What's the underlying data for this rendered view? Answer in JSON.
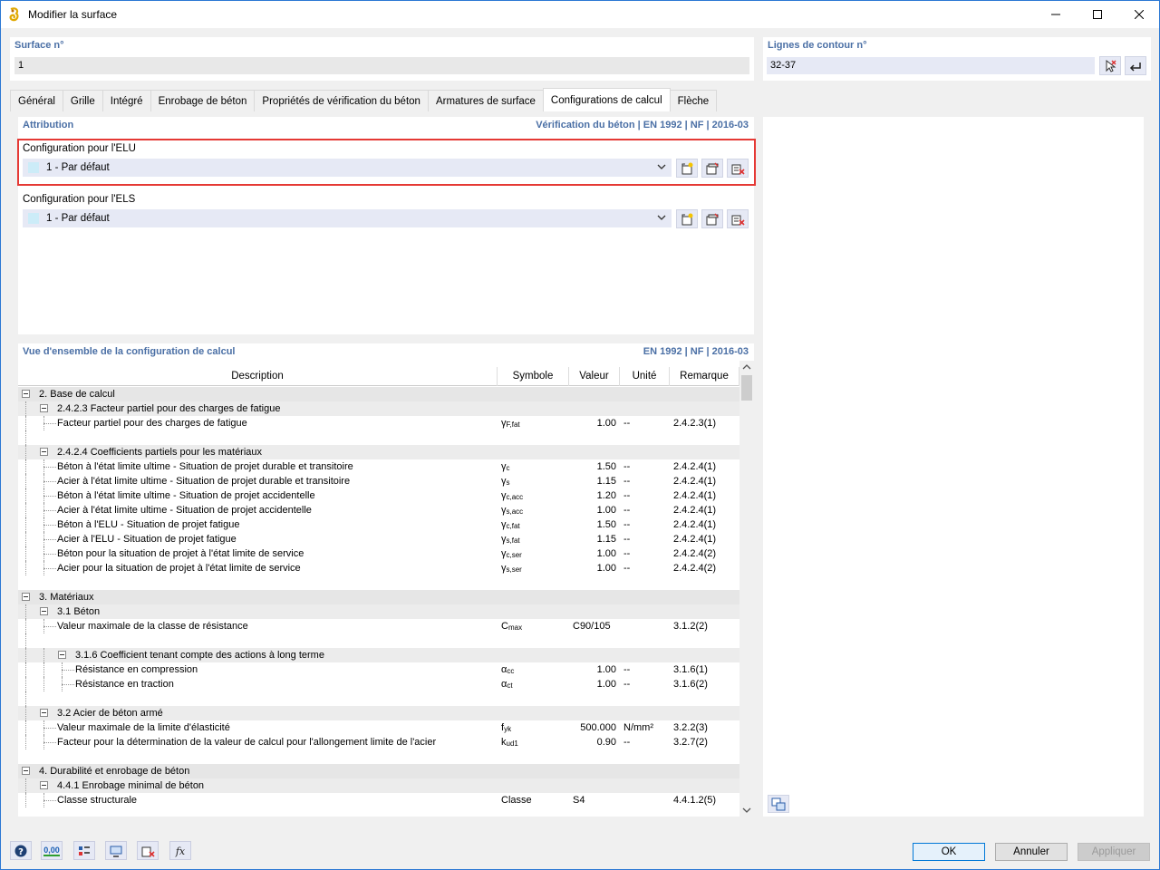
{
  "window": {
    "title": "Modifier la surface"
  },
  "surface": {
    "label": "Surface n°",
    "value": "1"
  },
  "contour": {
    "label": "Lignes de contour n°",
    "value": "32-37"
  },
  "tabs": [
    {
      "label": "Général"
    },
    {
      "label": "Grille"
    },
    {
      "label": "Intégré"
    },
    {
      "label": "Enrobage de béton"
    },
    {
      "label": "Propriétés de vérification du béton"
    },
    {
      "label": "Armatures de surface"
    },
    {
      "label": "Configurations de calcul",
      "active": true
    },
    {
      "label": "Flèche"
    }
  ],
  "attribution": {
    "title": "Attribution",
    "standard": "Vérification du béton | EN 1992 | NF | 2016-03",
    "elu": {
      "label": "Configuration pour l'ELU",
      "value": "1 - Par défaut",
      "swatch": "#ccecf8"
    },
    "els": {
      "label": "Configuration pour l'ELS",
      "value": "1 - Par défaut",
      "swatch": "#ccecf8"
    }
  },
  "overview": {
    "title": "Vue d'ensemble de la configuration de calcul",
    "standard": "EN 1992 | NF | 2016-03",
    "columns": {
      "desc": "Description",
      "sym": "Symbole",
      "val": "Valeur",
      "unit": "Unité",
      "rem": "Remarque"
    },
    "rows": [
      {
        "kind": "group",
        "level": 0,
        "desc": "2. Base de calcul"
      },
      {
        "kind": "group",
        "level": 1,
        "desc": "2.4.2.3 Facteur partiel pour des charges de fatigue"
      },
      {
        "kind": "leaf",
        "level": 2,
        "desc": "Facteur partiel pour des charges de fatigue",
        "sym": "γ",
        "symsub": "F,fat",
        "val": "1.00",
        "unit": "--",
        "rem": "2.4.2.3(1)"
      },
      {
        "kind": "spacer",
        "level": 1
      },
      {
        "kind": "group",
        "level": 1,
        "desc": "2.4.2.4 Coefficients partiels pour les matériaux"
      },
      {
        "kind": "leaf",
        "level": 2,
        "desc": "Béton à l'état limite ultime - Situation de projet durable et transitoire",
        "sym": "γ",
        "symsub": "c",
        "val": "1.50",
        "unit": "--",
        "rem": "2.4.2.4(1)"
      },
      {
        "kind": "leaf",
        "level": 2,
        "desc": "Acier à l'état limite ultime - Situation de projet durable et transitoire",
        "sym": "γ",
        "symsub": "s",
        "val": "1.15",
        "unit": "--",
        "rem": "2.4.2.4(1)"
      },
      {
        "kind": "leaf",
        "level": 2,
        "desc": "Béton à l'état limite ultime - Situation de projet accidentelle",
        "sym": "γ",
        "symsub": "c,acc",
        "val": "1.20",
        "unit": "--",
        "rem": "2.4.2.4(1)"
      },
      {
        "kind": "leaf",
        "level": 2,
        "desc": "Acier à l'état limite ultime - Situation de projet accidentelle",
        "sym": "γ",
        "symsub": "s,acc",
        "val": "1.00",
        "unit": "--",
        "rem": "2.4.2.4(1)"
      },
      {
        "kind": "leaf",
        "level": 2,
        "desc": "Béton à l'ELU - Situation de projet fatigue",
        "sym": "γ",
        "symsub": "c,fat",
        "val": "1.50",
        "unit": "--",
        "rem": "2.4.2.4(1)"
      },
      {
        "kind": "leaf",
        "level": 2,
        "desc": "Acier à l'ELU - Situation de projet fatigue",
        "sym": "γ",
        "symsub": "s,fat",
        "val": "1.15",
        "unit": "--",
        "rem": "2.4.2.4(1)"
      },
      {
        "kind": "leaf",
        "level": 2,
        "desc": "Béton pour la situation de projet à l'état limite de service",
        "sym": "γ",
        "symsub": "c,ser",
        "val": "1.00",
        "unit": "--",
        "rem": "2.4.2.4(2)"
      },
      {
        "kind": "leaf",
        "level": 2,
        "desc": "Acier pour la situation de projet à l'état limite de service",
        "sym": "γ",
        "symsub": "s,ser",
        "val": "1.00",
        "unit": "--",
        "rem": "2.4.2.4(2)"
      },
      {
        "kind": "spacer",
        "level": 0
      },
      {
        "kind": "group",
        "level": 0,
        "desc": "3. Matériaux"
      },
      {
        "kind": "group",
        "level": 1,
        "desc": "3.1 Béton"
      },
      {
        "kind": "leaf",
        "level": 2,
        "desc": "Valeur maximale de la classe de résistance",
        "sym": "C",
        "symsub": "max",
        "val": "C90/105",
        "valAlign": "left",
        "unit": "",
        "rem": "3.1.2(2)"
      },
      {
        "kind": "spacer",
        "level": 1
      },
      {
        "kind": "group",
        "level": 2,
        "desc": "3.1.6 Coefficient tenant compte des actions à long terme"
      },
      {
        "kind": "leaf",
        "level": 3,
        "desc": "Résistance en compression",
        "sym": "α",
        "symsub": "cc",
        "val": "1.00",
        "unit": "--",
        "rem": "3.1.6(1)"
      },
      {
        "kind": "leaf",
        "level": 3,
        "desc": "Résistance en traction",
        "sym": "α",
        "symsub": "ct",
        "val": "1.00",
        "unit": "--",
        "rem": "3.1.6(2)"
      },
      {
        "kind": "spacer",
        "level": 1
      },
      {
        "kind": "group",
        "level": 1,
        "desc": "3.2 Acier de béton armé"
      },
      {
        "kind": "leaf",
        "level": 2,
        "desc": "Valeur maximale de la limite d'élasticité",
        "sym": "f",
        "symsub": "yk",
        "val": "500.000",
        "unit": "N/mm²",
        "rem": "3.2.2(3)"
      },
      {
        "kind": "leaf",
        "level": 2,
        "desc": "Facteur pour la détermination de la valeur de calcul pour l'allongement limite de l'acier",
        "sym": "k",
        "symsub": "ud1",
        "val": "0.90",
        "unit": "--",
        "rem": "3.2.7(2)"
      },
      {
        "kind": "spacer",
        "level": 0
      },
      {
        "kind": "group",
        "level": 0,
        "desc": "4. Durabilité et enrobage de béton"
      },
      {
        "kind": "group",
        "level": 1,
        "desc": "4.4.1 Enrobage minimal de béton"
      },
      {
        "kind": "leaf",
        "level": 2,
        "desc": "Classe structurale",
        "sym": "Classe",
        "symsub": "",
        "val": "S4",
        "valAlign": "left",
        "unit": "",
        "rem": "4.4.1.2(5)"
      }
    ]
  },
  "buttons": {
    "ok": "OK",
    "cancel": "Annuler",
    "apply": "Appliquer"
  },
  "toolbar": {
    "units_label": "0,00"
  }
}
